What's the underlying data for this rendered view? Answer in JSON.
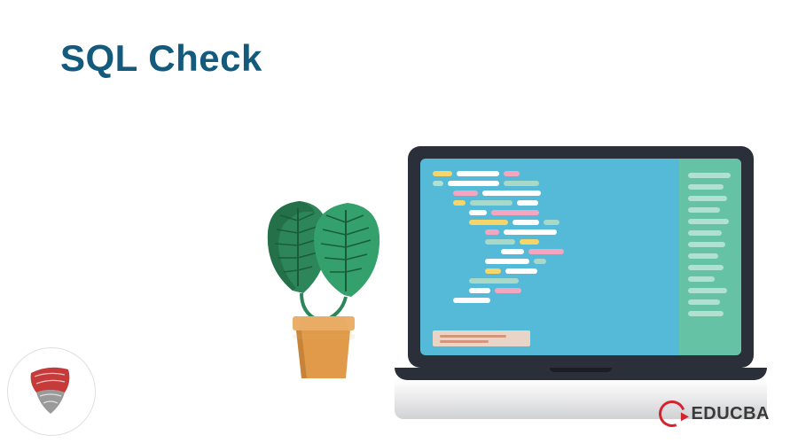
{
  "title": "SQL Check",
  "brand": {
    "name": "EDUCBA"
  },
  "colors": {
    "title": "#135a7d",
    "brand_accent": "#d4232c",
    "screen_bg": "#55b9d8",
    "panel_bg": "#66c2a5",
    "laptop_body": "#2b2f3a"
  },
  "illustration": {
    "laptop": {
      "code_lines": [
        [
          {
            "w": 22,
            "c": "#f8d568"
          },
          {
            "w": 48,
            "c": "#ffffff"
          },
          {
            "w": 18,
            "c": "#f4a5c0"
          }
        ],
        [
          {
            "w": 12,
            "c": "#b0e0d0"
          },
          {
            "w": 58,
            "c": "#ffffff"
          },
          {
            "w": 40,
            "c": "#a8d8c8"
          }
        ],
        [
          {
            "indent": 18
          },
          {
            "w": 28,
            "c": "#f4a5c0"
          },
          {
            "w": 66,
            "c": "#ffffff"
          }
        ],
        [
          {
            "indent": 18
          },
          {
            "w": 14,
            "c": "#f8d568"
          },
          {
            "w": 48,
            "c": "#a8d8c8"
          },
          {
            "w": 24,
            "c": "#ffffff"
          }
        ],
        [
          {
            "indent": 36
          },
          {
            "w": 20,
            "c": "#ffffff"
          },
          {
            "w": 54,
            "c": "#f4a5c0"
          }
        ],
        [
          {
            "indent": 36
          },
          {
            "w": 44,
            "c": "#f8d568"
          },
          {
            "w": 30,
            "c": "#ffffff"
          },
          {
            "w": 18,
            "c": "#a8d8c8"
          }
        ],
        [
          {
            "indent": 54
          },
          {
            "w": 16,
            "c": "#f4a5c0"
          },
          {
            "w": 60,
            "c": "#ffffff"
          }
        ],
        [
          {
            "indent": 54
          },
          {
            "w": 34,
            "c": "#a8d8c8"
          },
          {
            "w": 22,
            "c": "#f8d568"
          }
        ],
        [
          {
            "indent": 72
          },
          {
            "w": 26,
            "c": "#ffffff"
          },
          {
            "w": 40,
            "c": "#f4a5c0"
          }
        ],
        [
          {
            "indent": 54
          },
          {
            "w": 50,
            "c": "#ffffff"
          },
          {
            "w": 14,
            "c": "#a8d8c8"
          }
        ],
        [
          {
            "indent": 54
          },
          {
            "w": 18,
            "c": "#f8d568"
          },
          {
            "w": 36,
            "c": "#ffffff"
          }
        ],
        [
          {
            "indent": 36
          },
          {
            "w": 56,
            "c": "#a8d8c8"
          }
        ],
        [
          {
            "indent": 36
          },
          {
            "w": 24,
            "c": "#ffffff"
          },
          {
            "w": 30,
            "c": "#f4a5c0"
          }
        ],
        [
          {
            "indent": 18
          },
          {
            "w": 42,
            "c": "#ffffff"
          }
        ]
      ],
      "side_lines": [
        48,
        40,
        44,
        36,
        46,
        38,
        42,
        34,
        40,
        30,
        44,
        36,
        40
      ]
    }
  }
}
